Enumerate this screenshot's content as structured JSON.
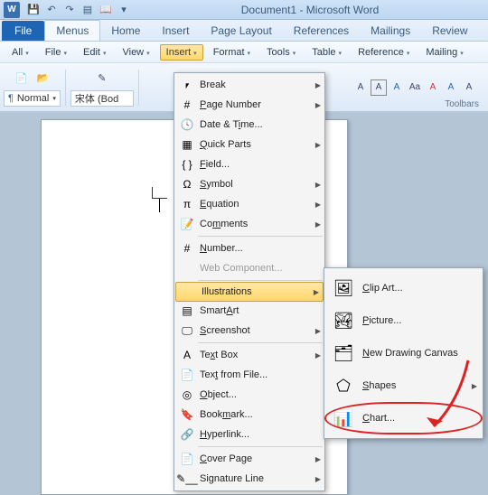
{
  "title": "Document1 - Microsoft Word",
  "tabs": {
    "file": "File",
    "list": [
      "Menus",
      "Home",
      "Insert",
      "Page Layout",
      "References",
      "Mailings",
      "Review"
    ]
  },
  "menubar": {
    "items": [
      "All",
      "File",
      "Edit",
      "View",
      "Insert",
      "Format",
      "Tools",
      "Table",
      "Reference",
      "Mailing"
    ]
  },
  "toolbar": {
    "style": "Normal",
    "font": "宋体 (Bod",
    "grouplabel": "Toolbars"
  },
  "insert_menu": [
    {
      "icon": "⎖",
      "label": "Break",
      "arrow": true
    },
    {
      "icon": "#",
      "label": "Page Number",
      "u": 0,
      "arrow": true
    },
    {
      "icon": "🕓",
      "label": "Date & Time...",
      "u": 8
    },
    {
      "icon": "▦",
      "label": "Quick Parts",
      "u": 0,
      "arrow": true
    },
    {
      "icon": "{ }",
      "label": "Field...",
      "u": 0
    },
    {
      "icon": "Ω",
      "label": "Symbol",
      "u": 0,
      "arrow": true
    },
    {
      "icon": "π",
      "label": "Equation",
      "u": 0,
      "arrow": true
    },
    {
      "icon": "📝",
      "label": "Comments",
      "u": 2,
      "arrow": true
    },
    {
      "sep": true
    },
    {
      "icon": "#",
      "label": "Number...",
      "u": 0
    },
    {
      "icon": "",
      "label": "Web Component...",
      "disabled": true
    },
    {
      "sep": true
    },
    {
      "icon": "",
      "label": "Illustrations",
      "hl": true,
      "arrow": true
    },
    {
      "icon": "▤",
      "label": "SmartArt",
      "u": 5
    },
    {
      "icon": "🖵",
      "label": "Screenshot",
      "u": 0,
      "arrow": true
    },
    {
      "sep": true
    },
    {
      "icon": "A",
      "label": "Text Box",
      "u": 2,
      "arrow": true
    },
    {
      "icon": "📄",
      "label": "Text from File...",
      "u": 3
    },
    {
      "icon": "◎",
      "label": "Object...",
      "u": 0
    },
    {
      "icon": "🔖",
      "label": "Bookmark...",
      "u": 4
    },
    {
      "icon": "🔗",
      "label": "Hyperlink...",
      "u": 0
    },
    {
      "sep": true
    },
    {
      "icon": "📄",
      "label": "Cover Page",
      "u": 0,
      "arrow": true
    },
    {
      "icon": "✎__",
      "label": "Signature Line",
      "u": 2,
      "arrow": true
    }
  ],
  "illustrations_submenu": [
    {
      "icon": "🖼",
      "label": "Clip Art...",
      "u": 0
    },
    {
      "icon": "🏞",
      "label": "Picture...",
      "u": 0
    },
    {
      "icon": "🗂",
      "label": "New Drawing Canvas",
      "u": 0
    },
    {
      "icon": "⬠",
      "label": "Shapes",
      "u": 0,
      "arrow": true
    },
    {
      "icon": "📊",
      "label": "Chart...",
      "u": 0,
      "circled": true
    }
  ]
}
